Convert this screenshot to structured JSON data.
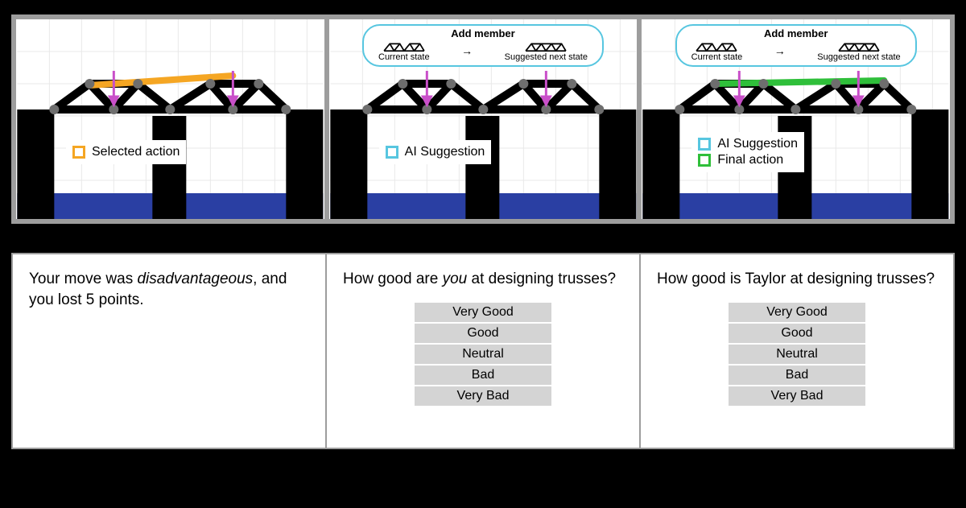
{
  "panels": {
    "p1": {
      "legend": [
        {
          "color": "#f5a623",
          "label": "Selected action"
        }
      ]
    },
    "p2": {
      "bubble": {
        "title": "Add member",
        "current_label": "Current state",
        "suggested_label": "Suggested next state"
      },
      "legend": [
        {
          "color": "#57c6e0",
          "label": "AI Suggestion"
        }
      ]
    },
    "p3": {
      "bubble": {
        "title": "Add member",
        "current_label": "Current state",
        "suggested_label": "Suggested next state"
      },
      "legend": [
        {
          "color": "#57c6e0",
          "label": "AI Suggestion"
        },
        {
          "color": "#2fbf3a",
          "label": "Final action"
        }
      ]
    }
  },
  "feedback": {
    "message_pre": "Your move was ",
    "message_em": "disadvantageous",
    "message_post": ", and you lost 5 points."
  },
  "q_self": {
    "prompt_pre": "How good are ",
    "prompt_em": "you",
    "prompt_post": " at designing trusses?",
    "options": [
      "Very Good",
      "Good",
      "Neutral",
      "Bad",
      "Very Bad"
    ]
  },
  "q_other": {
    "prompt": "How good is Taylor at designing trusses?",
    "options": [
      "Very Good",
      "Good",
      "Neutral",
      "Bad",
      "Very Bad"
    ]
  },
  "colors": {
    "selected": "#f5a623",
    "ai": "#57c6e0",
    "final": "#2fbf3a",
    "water": "#2a3fa3",
    "pier": "#000",
    "load": "#c94fc9"
  }
}
